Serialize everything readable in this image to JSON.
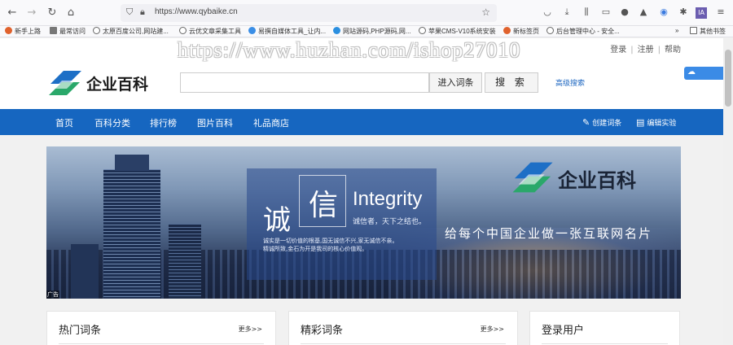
{
  "browser": {
    "url": "https://www.qybaike.cn",
    "bookmarks": [
      "新手上路",
      "最常访问",
      "太原百度公司,网站建...",
      "云优文章采集工具",
      "易撰自媒体工具_让内...",
      "网站源码,PHP源码,网...",
      "苹果CMS-V10系统安装",
      "新标签页",
      "后台管理中心 - 安全...",
      "其他书签"
    ],
    "icons": [
      "back-icon",
      "forward-icon",
      "reload-icon",
      "home-icon",
      "shield-icon",
      "lock-icon",
      "star-icon",
      "pocket-icon",
      "download-icon",
      "library-icon",
      "reader-icon",
      "account-icon",
      "extension-icon",
      "menu-icon"
    ]
  },
  "watermark": "https://www.huzhan.com/ishop27010",
  "toplinks": {
    "login": "登录",
    "register": "注册",
    "help": "帮助"
  },
  "header": {
    "logo_text": "企业百科",
    "search_placeholder": "",
    "enter_button": "进入词条",
    "search_button": "搜 索",
    "advanced_search": "高级搜索"
  },
  "nav": {
    "items": [
      "首页",
      "百科分类",
      "排行榜",
      "图片百科",
      "礼品商店"
    ],
    "create": "创建词条",
    "edit": "编辑实验"
  },
  "banner": {
    "char1": "诚",
    "char2": "信",
    "integrity": "Integrity",
    "motto": "诚信者，天下之结也。",
    "line1": "诚实是一切价值的根基,国无诚信不兴,家无诚信不亲。",
    "line2": "精诚所致,金石为开是我司的核心价值观。",
    "logo_text": "企业百科",
    "slogan": "给每个中国企业做一张互联网名片",
    "ad_tag": "广告"
  },
  "cards": [
    {
      "title": "热门词条",
      "more": "更多>>"
    },
    {
      "title": "精彩词条",
      "more": "更多>>"
    },
    {
      "title": "登录用户",
      "more": ""
    }
  ],
  "colors": {
    "nav_blue": "#1666c0",
    "logo_green": "#2aa86a",
    "logo_blue": "#1d6fc6",
    "link_blue": "#1c66c0"
  }
}
